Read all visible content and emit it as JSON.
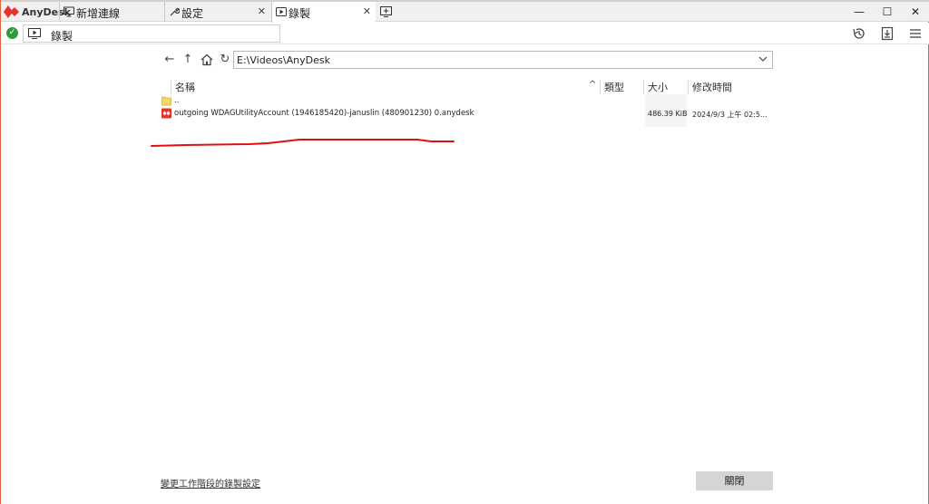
{
  "app": {
    "name": "AnyDesk",
    "brand_color": "#e8312a"
  },
  "tabs": [
    {
      "label": "新增連線",
      "icon": "monitor-icon"
    },
    {
      "label": "設定",
      "icon": "wrench-icon",
      "close": "✕"
    },
    {
      "label": "錄製",
      "icon": "play-icon",
      "close": "✕",
      "active": true
    }
  ],
  "window_controls": {
    "minimize": "—",
    "maximize": "☐",
    "close": "✕"
  },
  "address": {
    "value": "錄製",
    "status_icon": "check-circle-icon"
  },
  "path": {
    "value": "E:\\Videos\\AnyDesk"
  },
  "columns": {
    "name": "名稱",
    "type": "類型",
    "size": "大小",
    "modified": "修改時間",
    "sort_indicator": "^"
  },
  "files": [
    {
      "name": "..",
      "icon": "folder-icon",
      "size": "",
      "modified": ""
    },
    {
      "name": "outgoing WDAGUtilityAccount (1946185420)-januslin (480901230) 0.anydesk",
      "icon": "anydesk-file-icon",
      "size": "486.39 KiB",
      "modified": "2024/9/3 上午 02:5..."
    }
  ],
  "footer": {
    "settings_link": "變更工作階段的錄製設定",
    "close_button": "關閉"
  }
}
